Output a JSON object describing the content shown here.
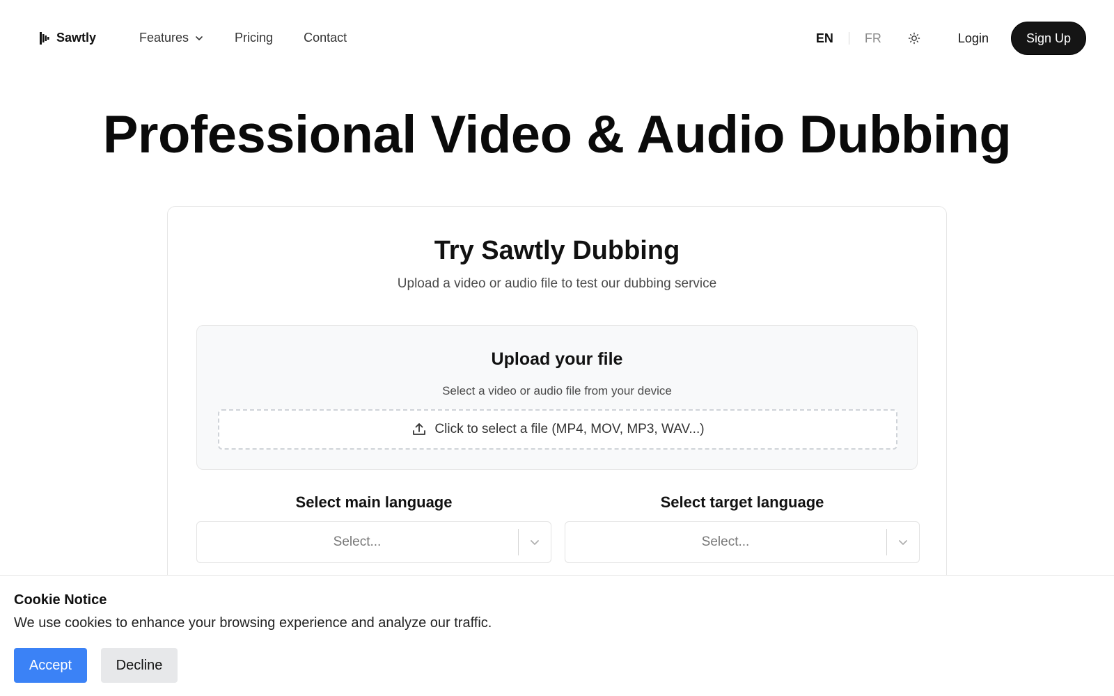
{
  "header": {
    "brand": "Sawtly",
    "nav": [
      {
        "label": "Features",
        "has_dropdown": true
      },
      {
        "label": "Pricing"
      },
      {
        "label": "Contact"
      }
    ],
    "languages": {
      "active": "EN",
      "inactive": "FR"
    },
    "theme_icon": "sun-icon",
    "login_label": "Login",
    "signup_label": "Sign Up"
  },
  "hero": {
    "title": "Professional Video & Audio Dubbing"
  },
  "card": {
    "title": "Try Sawtly Dubbing",
    "subtitle": "Upload a video or audio file to test our dubbing service",
    "upload": {
      "title": "Upload your file",
      "subtitle": "Select a video or audio file from your device",
      "dropzone_label": "Click to select a file (MP4, MOV, MP3, WAV...)",
      "icon": "upload-icon"
    },
    "main_language": {
      "label": "Select main language",
      "placeholder": "Select..."
    },
    "target_language": {
      "label": "Select target language",
      "placeholder": "Select..."
    }
  },
  "cookie": {
    "title": "Cookie Notice",
    "text": "We use cookies to enhance your browsing experience and analyze our traffic.",
    "accept_label": "Accept",
    "decline_label": "Decline"
  },
  "colors": {
    "accent": "#3b82f6",
    "signup_bg": "#151515",
    "upload_bg": "#f8f9fa"
  }
}
